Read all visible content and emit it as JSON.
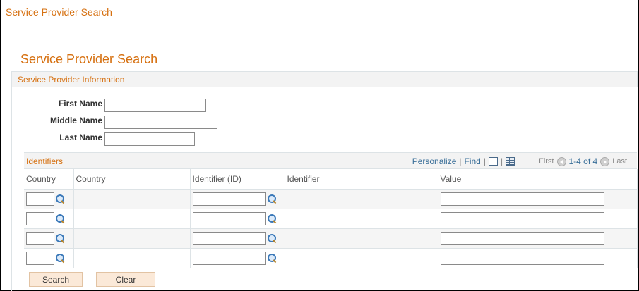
{
  "window": {
    "title": "Service Provider Search"
  },
  "page": {
    "title": "Service Provider Search"
  },
  "section": {
    "title": "Service Provider Information"
  },
  "form": {
    "first_name_label": "First Name",
    "first_name_value": "",
    "middle_name_label": "Middle Name",
    "middle_name_value": "",
    "last_name_label": "Last Name",
    "last_name_value": ""
  },
  "identifiers": {
    "title": "Identifiers",
    "personalize": "Personalize",
    "separator": "|",
    "find": "Find",
    "first": "First",
    "range": "1-4 of 4",
    "last": "Last",
    "columns": [
      "Country",
      "Country",
      "Identifier (ID)",
      "Identifier",
      "Value"
    ],
    "rows": [
      {
        "country": "",
        "country_desc": "",
        "identifier_id": "",
        "identifier_desc": "",
        "value": ""
      },
      {
        "country": "",
        "country_desc": "",
        "identifier_id": "",
        "identifier_desc": "",
        "value": ""
      },
      {
        "country": "",
        "country_desc": "",
        "identifier_id": "",
        "identifier_desc": "",
        "value": ""
      },
      {
        "country": "",
        "country_desc": "",
        "identifier_id": "",
        "identifier_desc": "",
        "value": ""
      }
    ]
  },
  "buttons": {
    "search": "Search",
    "clear": "Clear"
  },
  "colors": {
    "accent": "#d67010",
    "link": "#3a6f99",
    "button_bg": "#fbe9d8"
  }
}
